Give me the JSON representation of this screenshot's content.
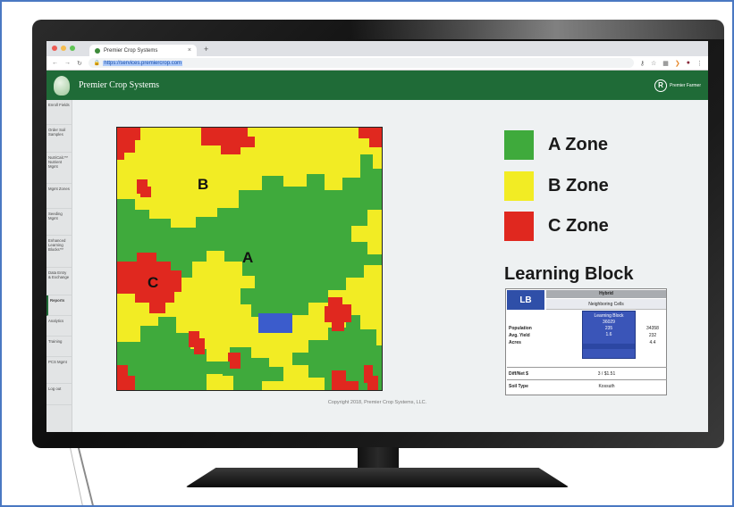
{
  "browser": {
    "tab_title": "Premier Crop Systems",
    "tab_close": "×",
    "new_tab": "+",
    "url": "https://services.premiercrop.com",
    "traffic_light_colors": [
      "#ee5c54",
      "#f5bd4f",
      "#5fc454"
    ]
  },
  "app": {
    "title": "Premier Crop Systems",
    "user_initial": "R",
    "user_name": "Premier Farmer",
    "brand_color": "#1f6b37"
  },
  "sidebar": {
    "items": [
      {
        "label": "Enroll Fields"
      },
      {
        "label": "Order Soil Samples"
      },
      {
        "label": "NutriCalc™ Nutrient Mgmt"
      },
      {
        "label": "Mgmt Zones"
      },
      {
        "label": "Seeding Mgmt"
      },
      {
        "label": "Enhanced Learning Blocks™"
      },
      {
        "label": "Data Entry & Exchange"
      },
      {
        "label": "Reports"
      },
      {
        "label": "Analytics"
      },
      {
        "label": "Training"
      },
      {
        "label": "PCS Mgmt"
      },
      {
        "label": "Log out"
      }
    ]
  },
  "map": {
    "zone_labels": {
      "a": "A",
      "b": "B",
      "c": "C"
    },
    "colors": {
      "a": "#3faa3c",
      "b": "#f2ec24",
      "c": "#e0281f",
      "learning_block": "#3b5ccc"
    }
  },
  "legend": {
    "items": [
      {
        "label": "A Zone",
        "color": "#3faa3c"
      },
      {
        "label": "B Zone",
        "color": "#f2ec24"
      },
      {
        "label": "C Zone",
        "color": "#e0281f"
      }
    ]
  },
  "learning_block": {
    "title": "Learning Block",
    "badge": "LB",
    "hybrid": "Hybrid",
    "neighboring": "Neighboring Cells",
    "row_labels": [
      "Population",
      "Avg. Yield",
      "Acres"
    ],
    "center_title": "Learning Block",
    "center_values": [
      "36029",
      "235",
      "1.6"
    ],
    "right_values": [
      "34358",
      "232",
      "4.4"
    ],
    "diff_label": "Diff/Net $",
    "diff_value": "3 / $1.51",
    "soil_label": "Soil Type",
    "soil_value": "Kossuth"
  },
  "footer": {
    "copyright": "Copyright 2018, Premier Crop Systems, LLC."
  }
}
